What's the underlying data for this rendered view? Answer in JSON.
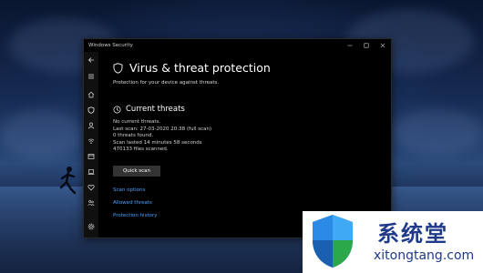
{
  "window": {
    "title": "Windows Security"
  },
  "nav": {
    "items": [
      {
        "icon": "back-icon"
      },
      {
        "icon": "menu-icon"
      },
      {
        "icon": "home-icon"
      },
      {
        "icon": "shield-icon"
      },
      {
        "icon": "person-icon"
      },
      {
        "icon": "wifi-icon"
      },
      {
        "icon": "app-browser-icon"
      },
      {
        "icon": "laptop-icon"
      },
      {
        "icon": "heart-icon"
      },
      {
        "icon": "family-icon"
      },
      {
        "icon": "gear-icon"
      }
    ]
  },
  "page": {
    "title": "Virus & threat protection",
    "subtitle": "Protection for your device against threats."
  },
  "current_threats": {
    "title": "Current threats",
    "lines": [
      "No current threats.",
      "Last scan: 27-03-2020 20:38 (full scan)",
      "0 threats found.",
      "Scan lasted 14 minutes 58 seconds",
      "470133 files scanned."
    ],
    "quick_scan_label": "Quick scan"
  },
  "links": {
    "scan_options": "Scan options",
    "allowed_threats": "Allowed threats",
    "protection_history": "Protection history"
  },
  "watermark": {
    "chinese": "系统堂",
    "url": "xitongtang.com"
  },
  "colors": {
    "accent_link": "#4aa3ff",
    "window_bg": "#000000",
    "watermark_text": "#1f3a8a"
  }
}
